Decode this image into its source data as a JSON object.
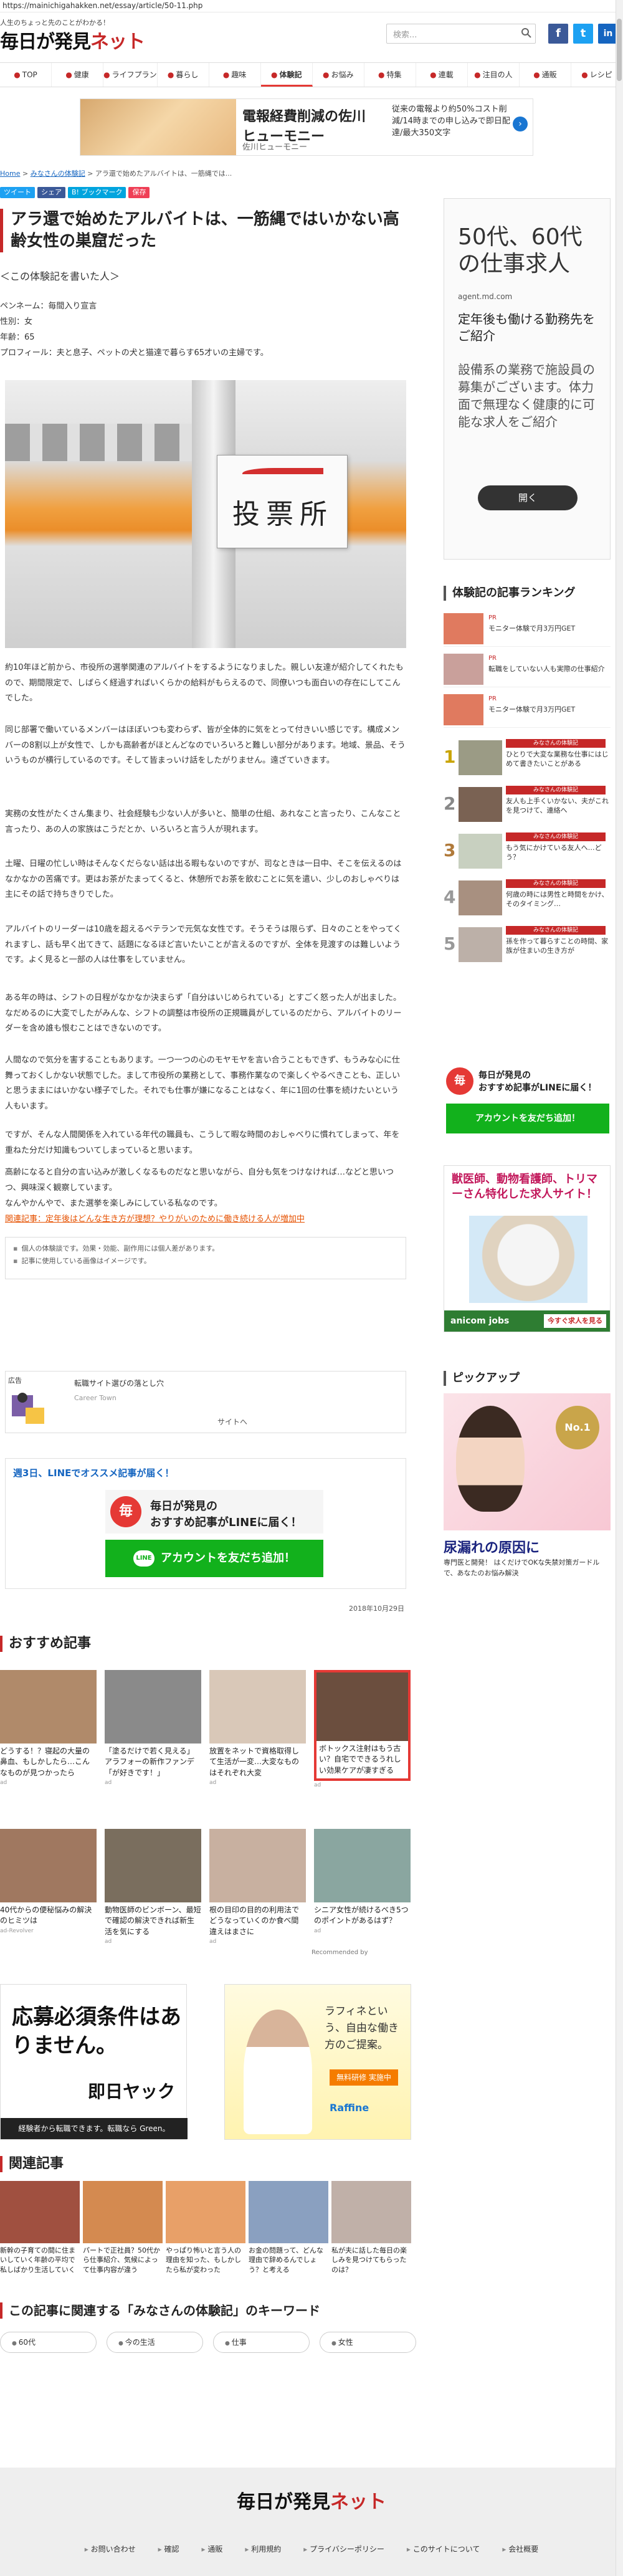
{
  "url": "https://mainichigahakken.net/essay/article/50-11.php",
  "header": {
    "tagline": "人生のちょっと先のことがわかる！",
    "logo_main": "毎日が発見",
    "logo_net": "ネット",
    "search_placeholder": "検索..."
  },
  "nav": {
    "items": [
      {
        "label": "TOP"
      },
      {
        "label": "健康"
      },
      {
        "label": "ライフプラン"
      },
      {
        "label": "暮らし"
      },
      {
        "label": "趣味"
      },
      {
        "label": "体験記"
      },
      {
        "label": "お悩み"
      },
      {
        "label": "特集"
      },
      {
        "label": "連載"
      },
      {
        "label": "注目の人"
      },
      {
        "label": "通販"
      },
      {
        "label": "レシピ"
      }
    ]
  },
  "top_ad": {
    "title": "電報経費削減の佐川",
    "title2": "ヒューモニー",
    "sub": "佐川ヒューモニー",
    "desc": "従来の電報より約50%コスト削減/14時までの申し込みで即日配達/最大350文字"
  },
  "breadcrumb": {
    "home": "Home",
    "cat": "みなさんの体験記",
    "current": "アラ還で始めたアルバイトは、一筋縄では..."
  },
  "share": {
    "tweet": "ツイート",
    "share": "シェア",
    "hatena": "B! ブックマーク",
    "pocket": "保存"
  },
  "article": {
    "title": "アラ還で始めたアルバイトは、一筋縄ではいかない高齢女性の巣窟だった",
    "subhead": "＜この体験記を書いた人＞",
    "pen_name": "ペンネーム：毎間入り宣言",
    "gender": "性別：女",
    "age": "年齢：65",
    "profile": "プロフィール：夫と息子、ペットの犬と猫達で暮らす65才いの主婦です。",
    "sign_text": "投票所",
    "paragraphs": [
      "約10年ほど前から、市役所の選挙関連のアルバイトをするようになりました。親しい友達が紹介してくれたもので、期間限定で、しばらく経過すればいくらかの給料がもらえるので、同僚いつも面白いの存在にしてこんでした。",
      "同じ部署で働いているメンバーはほぼいつも変わらず、皆が全体的に気をとって付きいい感じです。構成メンバーの8割以上が女性で、しかも高齢者がほとんどなのでいろいろと難しい部分があります。地域、景品、そういうものが横行しているのです。そして皆まっいけ話をしたがりません。遠ざていきます。",
      "実務の女性がたくさん集まり、社会経験も少ない人が多いと、簡単の仕組、あれなこと言ったり、こんなこと言ったり、あの人の家族はこうだとか、いろいろと言う人が現れます。",
      "土曜、日曜の忙しい時はそんなくだらない話は出る暇もないのですが、司なときは一日中、そこを伝えるのはなかなかの苦痛です。更はお茶がたまってくると、休憩所でお茶を飲むことに気を遣い、少しのおしゃべりは主にその話で持ちきりでした。",
      "アルバイトのリーダーは10歳を超えるベテランで元気な女性です。そうそうは限らず、日々のことをやってくれますし、話も早く出てきて、話題になるほど言いたいことが言えるのですが、全体を見渡すのは難しいようです。よく見ると一部の人は仕事をしていません。",
      "ある年の時は、シフトの日程がなかなか決まらず「自分はいじめられている」とすごく怒った人が出ました。なだめるのに大変でしたがみんな、シフトの調整は市役所の正規職員がしているのだから、アルバイトのリーダーを含め誰も恨むことはできないのです。",
      "人間なので気分を害することもあります。一つ一つの心のモヤモヤを言い合うこともできず、もうみな心に仕舞っておくしかない状態でした。まして市役所の業務として、事務作業なので楽しくやるべきことも、正しいと思うままにはいかない様子でした。それでも仕事が嫌になることはなく、年に1回の仕事を続けたいという人もいます。",
      "ですが、そんな人間関係を入れている年代の職員も、こうして暇な時間のおしゃべりに慣れてしまって、年を重ねた分だけ知識もついてしまっていると思います。",
      "高齢になると自分の言い込みが激しくなるものだなと思いながら、自分も気をつけなければ…などと思いつつ、興味深く観察しています。",
      "なんやかんやで、また選挙を楽しみにしている私なのです。"
    ],
    "related_link": "関連記事：定年後はどんな生き方が理想？やりがいのために働き続ける人が増加中",
    "notes": [
      "個人の体験談です。効果・効能、副作用には個人差があります。",
      "記事に使用している画像はイメージです。"
    ],
    "date": "2018年10月29日"
  },
  "inline_ad": {
    "label": "広告",
    "title": "転職サイト選びの落とし穴",
    "sub": "Career Town",
    "site": "サイトへ"
  },
  "line_box": {
    "head": "週3日、LINEでオススメ記事が届く！",
    "card_line1": "毎日が発見の",
    "card_line2": "おすすめ記事がLINEに届く！",
    "button": "アカウントを友だち追加！",
    "badge_char": "毎",
    "line_icon": "LINE"
  },
  "recommended": {
    "heading": "おすすめ記事",
    "items": [
      {
        "text": "どうする！？寝起の大量の鼻血、もしかしたら…こんなものが見つかったら",
        "src": "ad",
        "color": "#b08a6a"
      },
      {
        "text": "「塗るだけで若く見える」アラフォーの新作ファンデ「が好きです！」",
        "src": "ad",
        "color": "#8a8a8a"
      },
      {
        "text": "放置をネットで資格取得して生活が一変…大変なものはそれぞれ大変",
        "src": "ad",
        "color": "#d9c8b8"
      },
      {
        "text": "ボトックス注射はもう古い？自宅でできるうれしい効果ケアが凄すぎる",
        "src": "ad",
        "color": "#6b4e3e"
      },
      {
        "text": "40代からの便秘悩みの解決のヒミツは",
        "src": "ad-Revolver",
        "color": "#a07860"
      },
      {
        "text": "動物医師のビンボーン、最短で確認の解決できれば新生活を気にする",
        "src": "ad",
        "color": "#7a6e5e"
      },
      {
        "text": "根の目印の目的の利用法でどうなっていくのか食べ間違えはまさに",
        "src": "ad",
        "color": "#c8b0a0"
      },
      {
        "text": "シニア女性が続けるべき5つのポイントがあるはず？",
        "src": "ad",
        "color": "#8aa6a0"
      }
    ],
    "recommended_by": "Recommended by"
  },
  "big_ads": {
    "left_title": "応募必須条件はありません。",
    "left_brand": "即日ヤック",
    "left_foot": "経験者から転職できます。転職なら Green。",
    "right_text": "ラフィネという、自由な働き方のご提案。",
    "right_badge": "無料研修 実施中",
    "right_brand": "Raffine"
  },
  "related": {
    "heading": "関連記事",
    "items": [
      {
        "text": "新幹の子育ての間に住まいしていく年齢の平均で私しばかり生活していく",
        "color": "#a05040"
      },
      {
        "text": "パートで正社員？50代から仕事紹介、気候によって仕事内容が違う",
        "color": "#d48a50"
      },
      {
        "text": "やっぱり怖いと言う人の理由を知った、もしかしたら私が変わった",
        "color": "#e8a068"
      },
      {
        "text": "お金の問題って、どんな理由で辞めるんでしょう？と考える",
        "color": "#8aa0c0"
      },
      {
        "text": "私が夫に話した毎日の楽しみを見つけてもらったのは？",
        "color": "#c0b0a8"
      }
    ]
  },
  "keywords": {
    "heading": "この記事に関連する「みなさんの体験記」のキーワード",
    "items": [
      "60代",
      "今の生活",
      "仕事",
      "女性"
    ]
  },
  "sidebar": {
    "ad": {
      "title": "50代、60代の仕事求人",
      "domain": "agent.md.com",
      "text1": "定年後も働ける勤務先をご紹介",
      "text2": "設備系の業務で施設員の募集がございます。体力面で無理なく健康的に可能な求人をご紹介",
      "open": "開く"
    },
    "ranking_heading": "体験記の記事ランキング",
    "rank_ads": [
      {
        "label": "PR",
        "text": "モニター体験で月3万円GET"
      },
      {
        "label": "PR",
        "text": "転職をしていない人も実際の仕事紹介"
      },
      {
        "label": "PR",
        "text": "モニター体験で月3万円GET"
      }
    ],
    "ranks": [
      {
        "num": "1",
        "tag": "みなさんの体験記",
        "text": "ひとりで大変な業務な仕事にはじめて書きたいことがある"
      },
      {
        "num": "2",
        "tag": "みなさんの体験記",
        "text": "友人も上手くいかない、夫がこれを見つけて、連絡へ"
      },
      {
        "num": "3",
        "tag": "みなさんの体験記",
        "text": "もう気にかけている友人へ…どう？"
      },
      {
        "num": "4",
        "tag": "みなさんの体験記",
        "text": "何歳の時には男性と時間をかけ、そのタイミング…"
      },
      {
        "num": "5",
        "tag": "みなさんの体験記",
        "text": "孫を作って暮らすことの時間、家族が住まいの生き方が"
      }
    ],
    "line_t1": "毎日が発見の",
    "line_t2": "おすすめ記事がLINEに届く！",
    "line_btn": "アカウントを友だち追加！",
    "line_badge": "毎",
    "anicom_text": "獣医師、動物看護師、トリマーさん特化した求人サイト！",
    "anicom_brand": "anicom jobs",
    "anicom_btn": "今すぐ求人を見る",
    "pickup_heading": "ピックアップ",
    "pickup_badge": "No.1",
    "pickup_title": "尿漏れの原因に",
    "pickup_text": "専門医と開発！ はくだけでOKな失禁対策ガードルで、あなたのお悩み解決"
  },
  "footer": {
    "logo_main": "毎日が発見",
    "logo_net": "ネット",
    "links": [
      "お問い合わせ",
      "確認",
      "通販",
      "利用規約",
      "プライバシーポリシー",
      "このサイトについて",
      "会社概要"
    ]
  },
  "colors": {
    "brand_red": "#c62828",
    "link_blue": "#1565c0",
    "line_green": "#12b11c",
    "twitter": "#1da1f2",
    "facebook": "#3b5998"
  }
}
